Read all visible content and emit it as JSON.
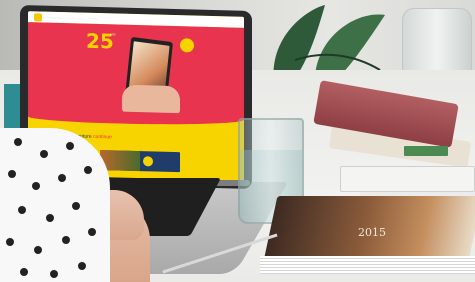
{
  "photo": {
    "description_tag": "laptop-on-desk-with-books"
  },
  "website": {
    "nav_items": [
      "· · · · · · ·",
      "· · · · · · ·",
      "· · · · ·"
    ],
    "hero_number": "25",
    "hero_text": "ans",
    "tagline_start": "L'Aventure",
    "tagline_highlight": "continue",
    "promo_text": ""
  },
  "magazine": {
    "title": "2015"
  },
  "colors": {
    "site_yellow": "#f7d400",
    "site_red": "#e8344e",
    "book_red": "#a34e53",
    "laptop_dark": "#2a2a2c"
  }
}
